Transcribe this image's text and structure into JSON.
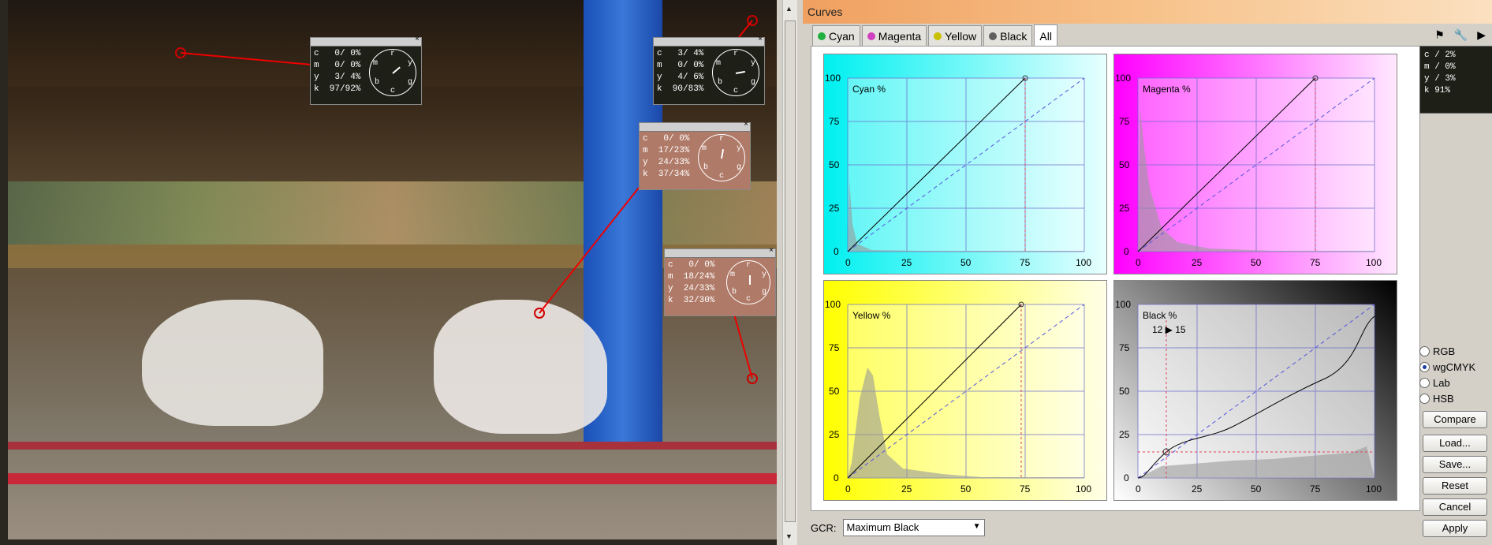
{
  "window": {
    "title": "Curves"
  },
  "tabs": [
    {
      "label": "Cyan",
      "color": "#20b040"
    },
    {
      "label": "Magenta",
      "color": "#d040c0"
    },
    {
      "label": "Yellow",
      "color": "#c8c000"
    },
    {
      "label": "Black",
      "color": "#606060"
    },
    {
      "label": "All"
    }
  ],
  "probes": [
    {
      "c": "c   0/ 0%",
      "m": "m   0/ 0%",
      "y": "y   3/ 4%",
      "k": "k  97/92%"
    },
    {
      "c": "c   3/ 4%",
      "m": "m   0/ 0%",
      "y": "y   4/ 6%",
      "k": "k  90/83%"
    },
    {
      "c": "c   0/ 0%",
      "m": "m  17/23%",
      "y": "y  24/33%",
      "k": "k  37/34%"
    },
    {
      "c": "c   0/ 0%",
      "m": "m  18/24%",
      "y": "y  24/33%",
      "k": "k  32/30%"
    }
  ],
  "dial_letters": {
    "m": "m",
    "r": "r",
    "y": "y",
    "b": "b",
    "c": "c",
    "g": "g"
  },
  "mini_readout": {
    "c": "c / 2%",
    "m": "m / 0%",
    "y": "y / 3%",
    "k": "k 91%"
  },
  "curves": {
    "cyan": {
      "label": "Cyan %",
      "bg_start": "#00f0f0",
      "bg_end": "#e8ffff"
    },
    "magenta": {
      "label": "Magenta %",
      "bg_start": "#ff00ff",
      "bg_end": "#ffe8ff"
    },
    "yellow": {
      "label": "Yellow %",
      "bg_start": "#ffff00",
      "bg_end": "#ffffe8"
    },
    "black": {
      "label": "Black %",
      "readout": "12 ▶ 15",
      "bg_start": "#000000",
      "bg_end": "#ffffff"
    },
    "y_ticks": [
      "100",
      "75",
      "50",
      "25",
      "0"
    ],
    "x_ticks": [
      "0",
      "25",
      "50",
      "75",
      "100"
    ]
  },
  "modes": [
    {
      "label": "RGB",
      "selected": false
    },
    {
      "label": "wgCMYK",
      "selected": true
    },
    {
      "label": "Lab",
      "selected": false
    },
    {
      "label": "HSB",
      "selected": false
    }
  ],
  "buttons": {
    "compare": "Compare",
    "load": "Load...",
    "save": "Save...",
    "reset": "Reset",
    "cancel": "Cancel",
    "apply": "Apply"
  },
  "gcr": {
    "label": "GCR:",
    "value": "Maximum Black"
  }
}
